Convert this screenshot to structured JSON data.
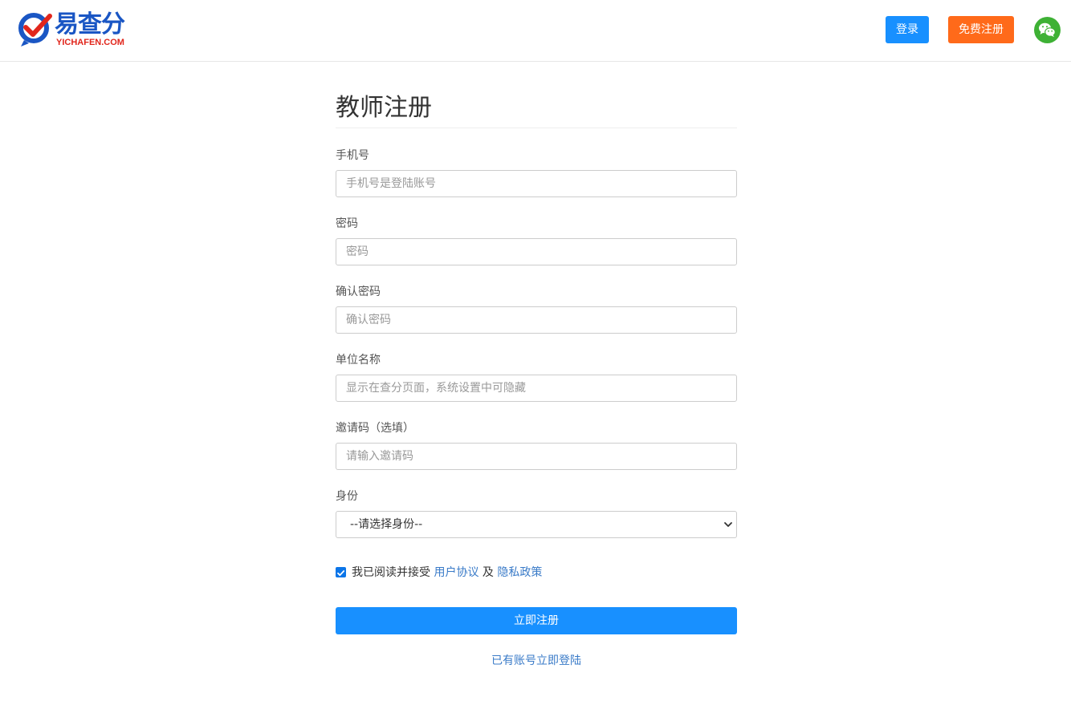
{
  "brand": {
    "name": "易查分",
    "domain": "YICHAFEN.COM"
  },
  "header": {
    "login_label": "登录",
    "register_label": "免费注册",
    "wechat_icon": "wechat-icon"
  },
  "form": {
    "title": "教师注册",
    "fields": [
      {
        "label": "手机号",
        "placeholder": "手机号是登陆账号",
        "value": ""
      },
      {
        "label": "密码",
        "placeholder": "密码",
        "value": ""
      },
      {
        "label": "确认密码",
        "placeholder": "确认密码",
        "value": ""
      },
      {
        "label": "单位名称",
        "placeholder": "显示在查分页面，系统设置中可隐藏",
        "value": ""
      },
      {
        "label": "邀请码（选填）",
        "placeholder": "请输入邀请码",
        "value": ""
      }
    ],
    "identity": {
      "label": "身份",
      "selected": "--请选择身份--"
    },
    "agreement": {
      "checked": true,
      "prefix": "我已阅读并接受",
      "user_agreement": "用户协议",
      "and": "及",
      "privacy_policy": "隐私政策"
    },
    "submit_label": "立即注册",
    "login_link": "已有账号立即登陆"
  },
  "colors": {
    "primary": "#1890ff",
    "orange": "#ff6a1a",
    "wechat": "#3eb135",
    "link": "#3a7bc8",
    "logo_blue": "#1a56c4",
    "logo_red": "#e1261c"
  }
}
